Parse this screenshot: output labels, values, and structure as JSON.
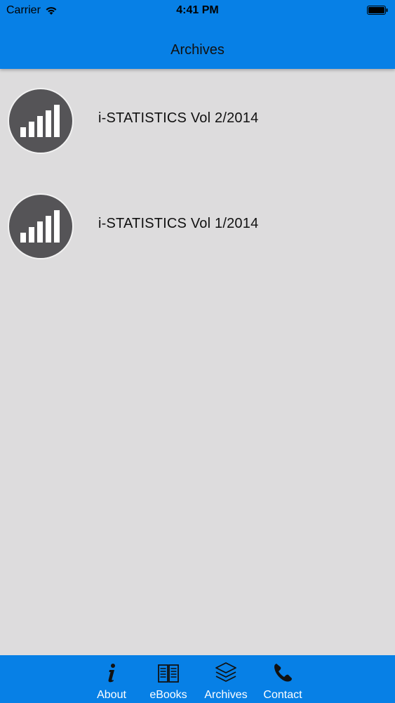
{
  "status_bar": {
    "carrier": "Carrier",
    "time": "4:41 PM"
  },
  "nav": {
    "title": "Archives"
  },
  "archives": [
    {
      "title": "i-STATISTICS Vol 2/2014",
      "icon": "bar-chart-icon"
    },
    {
      "title": "i-STATISTICS Vol 1/2014",
      "icon": "bar-chart-icon"
    }
  ],
  "tabbar": {
    "tabs": [
      {
        "label": "About",
        "icon": "info-icon"
      },
      {
        "label": "eBooks",
        "icon": "book-icon"
      },
      {
        "label": "Archives",
        "icon": "layers-icon",
        "selected": true
      },
      {
        "label": "Contact",
        "icon": "phone-icon"
      }
    ]
  },
  "colors": {
    "accent": "#0780e6",
    "background": "#dddcdd",
    "thumb": "#555457"
  }
}
